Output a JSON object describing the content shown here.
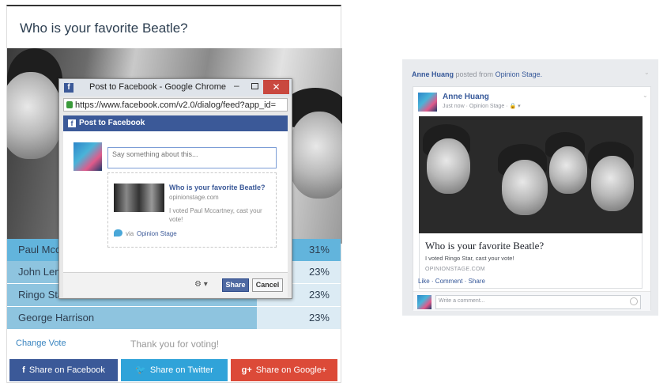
{
  "poll": {
    "title": "Who is your favorite Beatle?",
    "options": [
      {
        "label": "Paul Mcca",
        "percent": "31%",
        "fill": 1.0
      },
      {
        "label": "John Lenn",
        "percent": "23%",
        "fill": 0.75
      },
      {
        "label": "Ringo Star",
        "percent": "23%",
        "fill": 0.75
      },
      {
        "label": "George Harrison",
        "percent": "23%",
        "fill": 0.75
      }
    ],
    "change_vote": "Change Vote",
    "thanks": "Thank you for voting!",
    "share_facebook": "Share on Facebook",
    "share_twitter": "Share on Twitter",
    "share_google": "Share on Google+"
  },
  "dialog": {
    "title": "Post to Facebook - Google Chrome",
    "url": "https://www.facebook.com/v2.0/dialog/feed?app_id=",
    "header": "Post to Facebook",
    "placeholder": "Say something about this...",
    "preview_title": "Who is your favorite Beatle?",
    "preview_domain": "opinionstage.com",
    "preview_desc": "I voted Paul Mccartney, cast your vote!",
    "via": "via",
    "via_link": "Opinion Stage",
    "share": "Share",
    "cancel": "Cancel"
  },
  "fbpost": {
    "header_name": "Anne Huang",
    "header_posted": "posted from",
    "header_app": "Opinion Stage.",
    "author": "Anne Huang",
    "meta": "Just now · Opinion Stage ·",
    "link_title": "Who is your favorite Beatle?",
    "link_desc": "I voted Ringo Star, cast your vote!",
    "link_domain": "OPINIONSTAGE.COM",
    "actions": "Like · Comment · Share",
    "comment_placeholder": "Write a comment..."
  },
  "colors": {
    "poll_fill": "#8ec4df",
    "poll_fill_selected": "#62b4dc",
    "poll_bg": "#dcebf4",
    "facebook": "#3b5998",
    "twitter": "#30a3d9",
    "google": "#dc4a38"
  }
}
